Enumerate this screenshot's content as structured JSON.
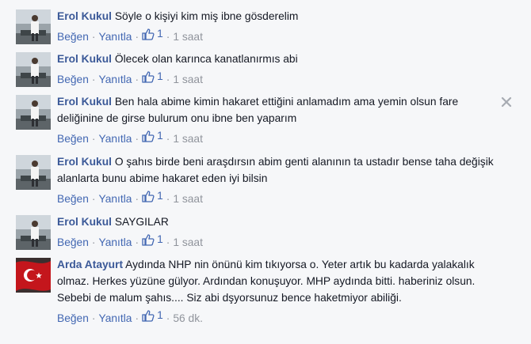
{
  "comments": [
    {
      "author": "Erol Kukul",
      "text": "Söyle o kişiyi kim miş ibne gösderelim",
      "like_label": "Beğen",
      "reply_label": "Yanıtla",
      "likes": "1",
      "time": "1 saat",
      "avatar_icon": "profile-photo-man"
    },
    {
      "author": "Erol Kukul",
      "text": "Ölecek olan karınca kanatlanırmıs abi",
      "like_label": "Beğen",
      "reply_label": "Yanıtla",
      "likes": "1",
      "time": "1 saat",
      "avatar_icon": "profile-photo-man"
    },
    {
      "author": "Erol Kukul",
      "text": "Ben hala abime kimin hakaret ettiğini anlamadım ama yemin olsun fare deliğinine de girse bulurum onu ibne ben yaparım",
      "like_label": "Beğen",
      "reply_label": "Yanıtla",
      "likes": "1",
      "time": "1 saat",
      "avatar_icon": "profile-photo-man",
      "has_close": true
    },
    {
      "author": "Erol Kukul",
      "text": "O şahıs birde beni araşdırsın abim genti alanının ta ustadır bense taha değişik alanlarta bunu abime hakaret eden iyi bilsin",
      "like_label": "Beğen",
      "reply_label": "Yanıtla",
      "likes": "1",
      "time": "1 saat",
      "avatar_icon": "profile-photo-man"
    },
    {
      "author": "Erol Kukul",
      "text": "SAYGILAR",
      "like_label": "Beğen",
      "reply_label": "Yanıtla",
      "likes": "1",
      "time": "1 saat",
      "avatar_icon": "profile-photo-man"
    },
    {
      "author": "Arda Atayurt",
      "text": "Aydında NHP nin önünü kim tıkıyorsa o. Yeter artık bu kadarda yalakalık olmaz. Herkes yüzüne gülyor. Ardından konuşuyor. MHP aydında bitti. haberiniz olsun. Sebebi de malum şahıs.... Siz abi dşyorsunuz bence haketmiyor abiliği.",
      "like_label": "Beğen",
      "reply_label": "Yanıtla",
      "likes": "1",
      "time": "56 dk.",
      "avatar_icon": "profile-photo-flag"
    }
  ],
  "colors": {
    "background": "#f6f7f9",
    "author": "#3b5998",
    "link": "#4267b2",
    "meta": "#90949c"
  },
  "icons": {
    "like": "thumbs-up-icon",
    "close": "close-icon"
  }
}
